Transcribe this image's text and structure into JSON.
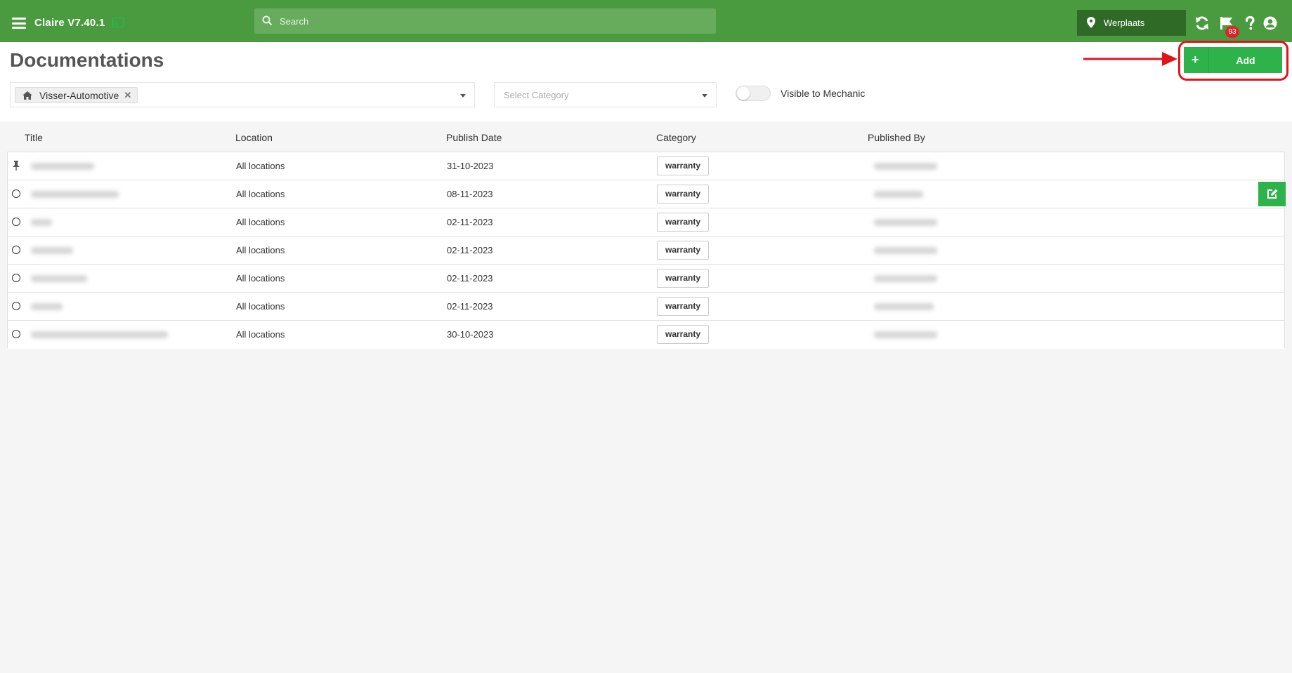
{
  "app": {
    "title": "Claire V7.40.1",
    "search_placeholder": "Search",
    "location": "Werplaats",
    "notifications_count": "93",
    "brand_color": "#4a9a3f",
    "accent_color": "#2db34a",
    "icons": [
      "menu-icon",
      "cast-icon",
      "search-icon",
      "map-pin-icon",
      "refresh-icon",
      "flag-icon",
      "help-icon",
      "user-icon"
    ]
  },
  "page": {
    "title": "Documentations",
    "add_label": "Add",
    "add_icon": "plus-icon"
  },
  "filters": {
    "location_tag": "Visser-Automotive",
    "category_placeholder": "Select Category",
    "visible_to_mechanic_label": "Visible to Mechanic",
    "visible_to_mechanic": false
  },
  "table": {
    "columns": [
      "Title",
      "Location",
      "Publish Date",
      "Category",
      "Published By"
    ],
    "rows": [
      {
        "pinned": true,
        "location": "All locations",
        "publish_date": "31-10-2023",
        "category": "warranty"
      },
      {
        "pinned": false,
        "location": "All locations",
        "publish_date": "08-11-2023",
        "category": "warranty"
      },
      {
        "pinned": false,
        "location": "All locations",
        "publish_date": "02-11-2023",
        "category": "warranty"
      },
      {
        "pinned": false,
        "location": "All locations",
        "publish_date": "02-11-2023",
        "category": "warranty"
      },
      {
        "pinned": false,
        "location": "All locations",
        "publish_date": "02-11-2023",
        "category": "warranty"
      },
      {
        "pinned": false,
        "location": "All locations",
        "publish_date": "02-11-2023",
        "category": "warranty"
      },
      {
        "pinned": false,
        "location": "All locations",
        "publish_date": "30-10-2023",
        "category": "warranty"
      }
    ]
  }
}
